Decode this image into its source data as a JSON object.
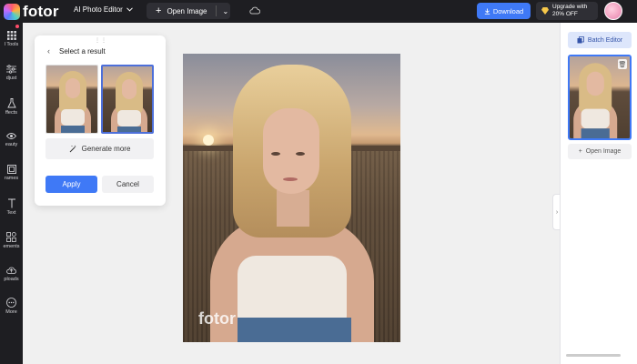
{
  "header": {
    "brand": "fotor",
    "editor_menu": "AI Photo Editor",
    "open_image": "Open Image",
    "download": "Download",
    "upgrade_line1": "Upgrade with",
    "upgrade_line2": "20% OFF"
  },
  "sidebar": {
    "items": [
      {
        "label": "l Tools",
        "icon": "grid-icon"
      },
      {
        "label": "djust",
        "icon": "adjust-icon"
      },
      {
        "label": "ffects",
        "icon": "flask-icon"
      },
      {
        "label": "eauty",
        "icon": "eye-icon"
      },
      {
        "label": "rames",
        "icon": "frame-icon"
      },
      {
        "label": "Text",
        "icon": "text-icon"
      },
      {
        "label": "ements",
        "icon": "shapes-icon"
      },
      {
        "label": "ploads",
        "icon": "upload-icon"
      },
      {
        "label": "More",
        "icon": "more-icon"
      }
    ]
  },
  "panel": {
    "title": "Select a result",
    "generate_more": "Generate more",
    "apply": "Apply",
    "cancel": "Cancel"
  },
  "canvas": {
    "watermark": "fotor"
  },
  "right_panel": {
    "batch_editor": "Batch Editor",
    "open_image": "Open Image"
  },
  "colors": {
    "accent": "#3f79f6",
    "topbar": "#1e1e22"
  }
}
